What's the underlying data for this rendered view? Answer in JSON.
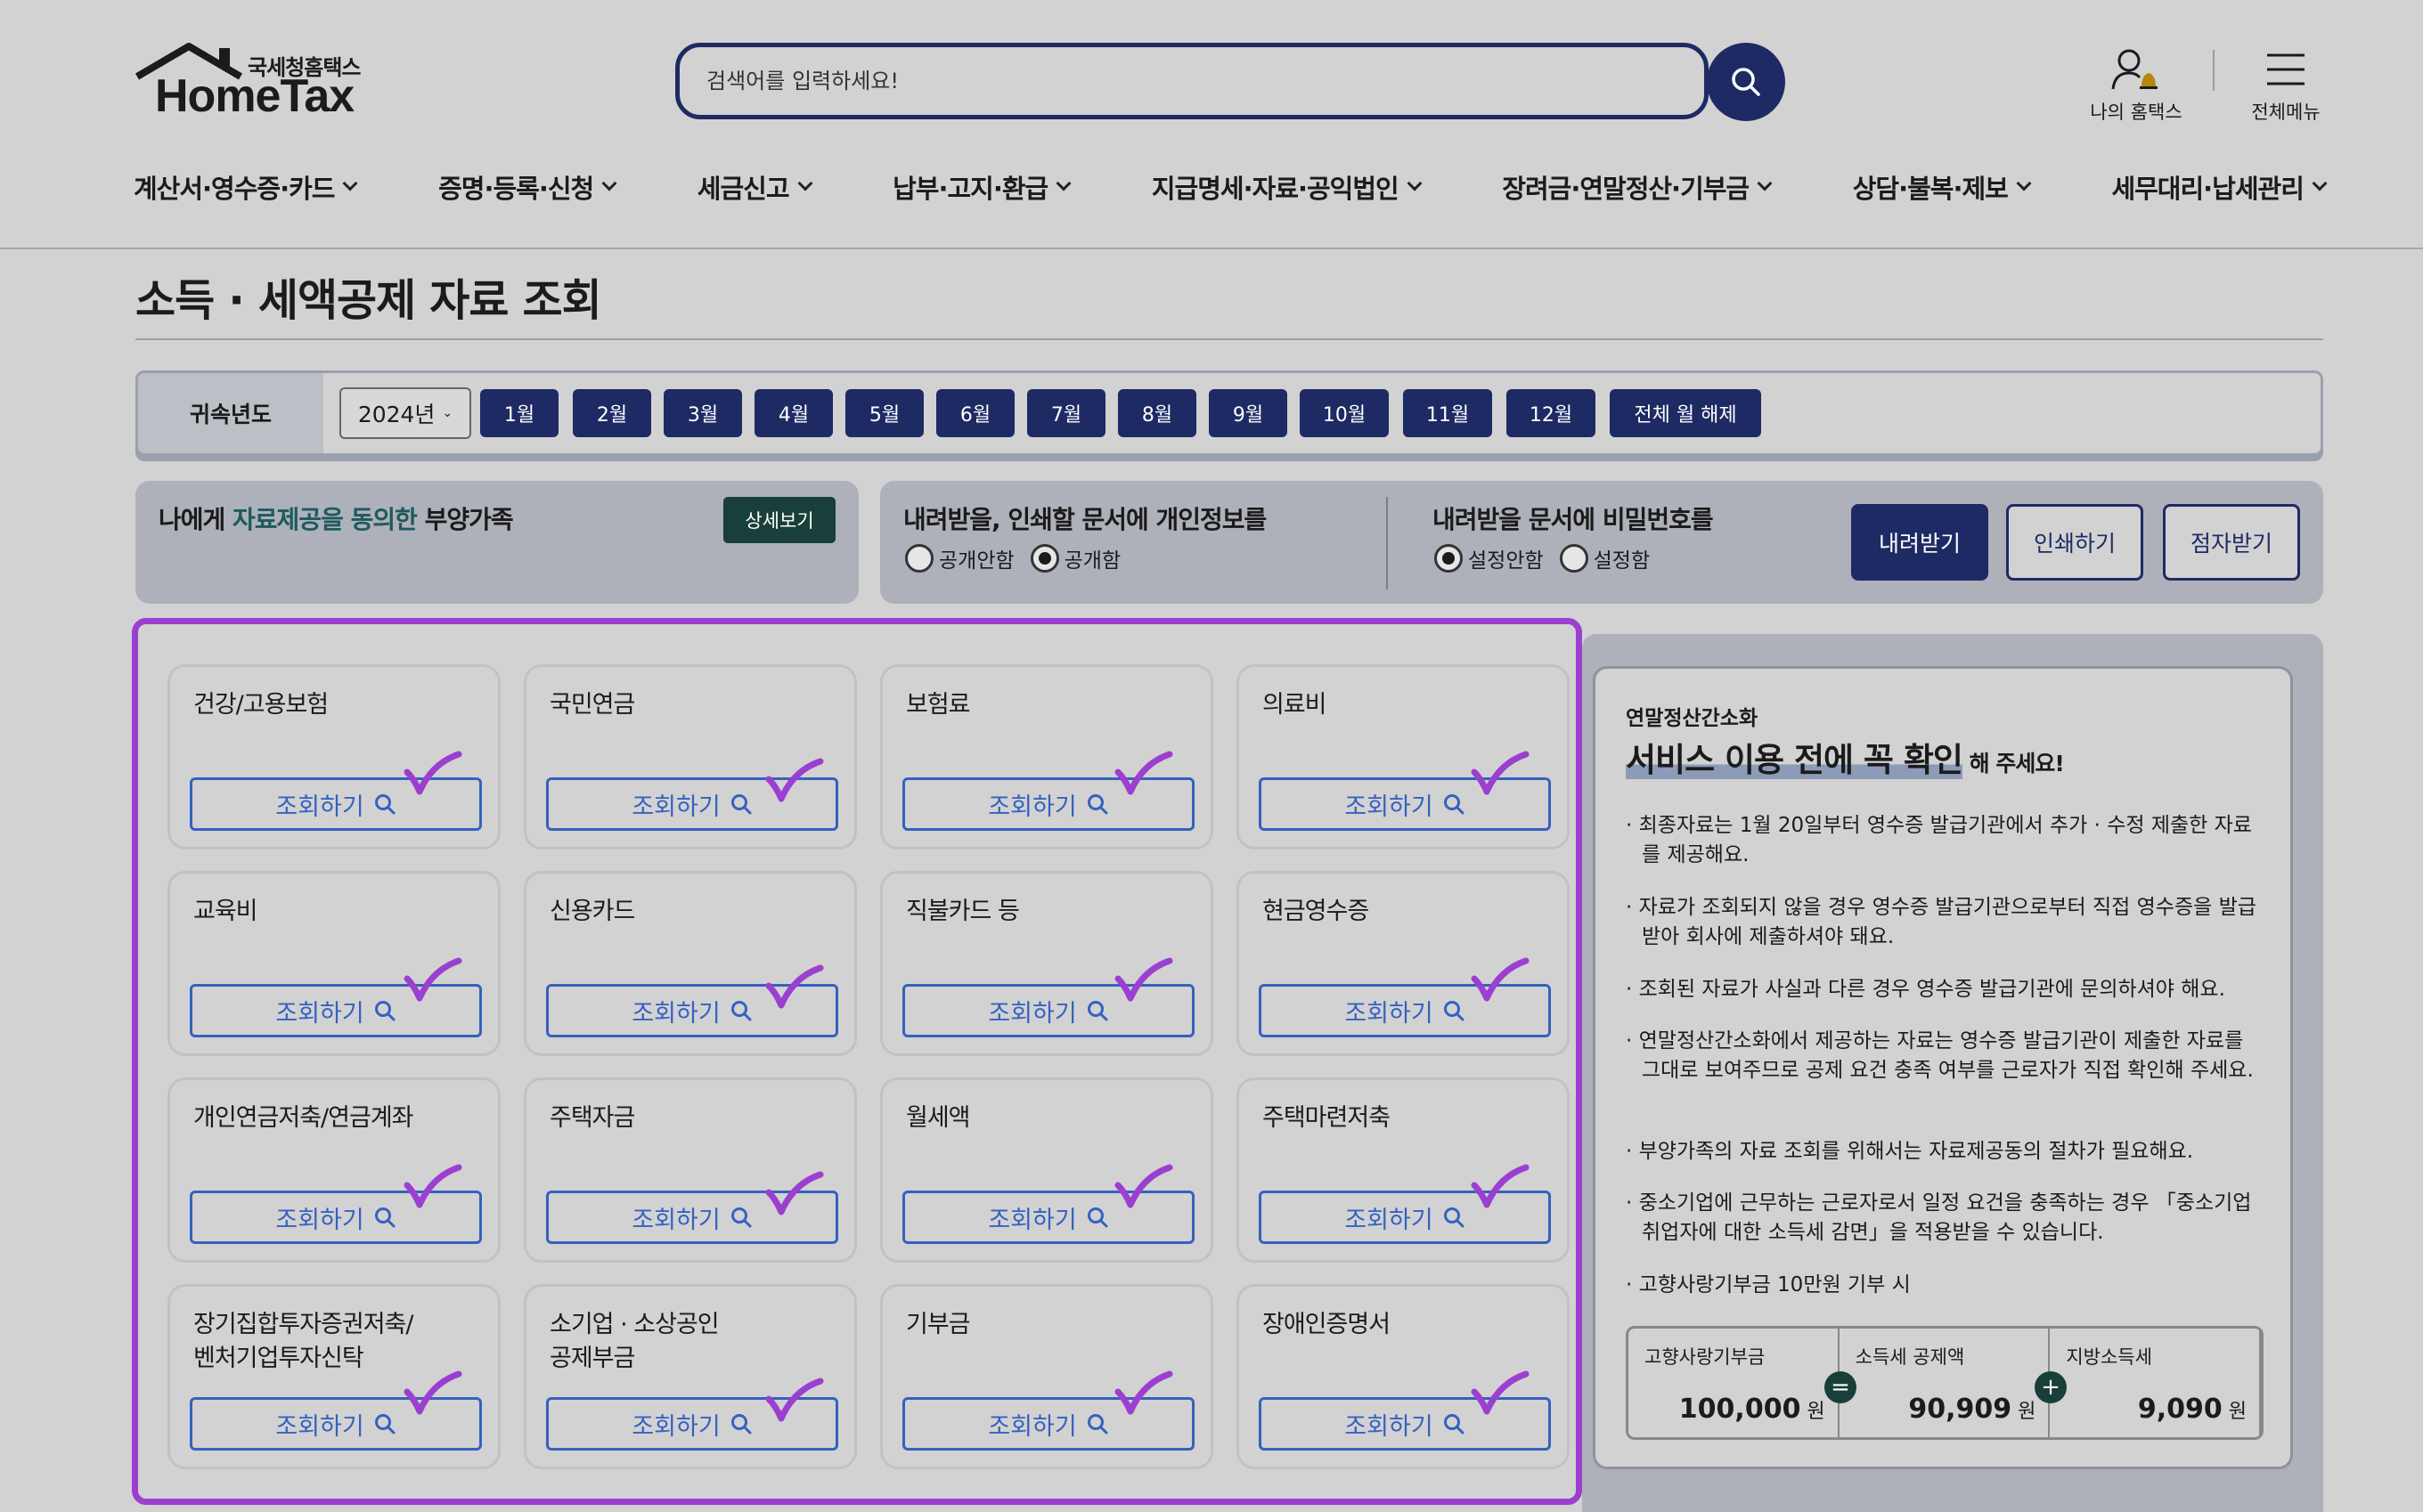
{
  "header": {
    "logo_sub": "국세청홈택스",
    "logo_main": "HomeTax",
    "search_placeholder": "검색어를 입력하세요!",
    "my_hometax": "나의 홈택스",
    "all_menu": "전체메뉴"
  },
  "nav": [
    "계산서·영수증·카드",
    "증명·등록·신청",
    "세금신고",
    "납부·고지·환급",
    "지급명세·자료·공익법인",
    "장려금·연말정산·기부금",
    "상담·불복·제보",
    "세무대리·납세관리"
  ],
  "page_title": "소득 · 세액공제 자료 조회",
  "year_bar": {
    "label": "귀속년도",
    "year": "2024년",
    "months": [
      "1월",
      "2월",
      "3월",
      "4월",
      "5월",
      "6월",
      "7월",
      "8월",
      "9월",
      "10월",
      "11월",
      "12월"
    ],
    "clear": "전체 월 해제"
  },
  "consent_panel": {
    "text_a": "나에게 ",
    "text_b": "자료제공을 동의한",
    "text_c": " 부양가족",
    "detail_button": "상세보기"
  },
  "options_panel": {
    "personal_info_title": "내려받을, 인쇄할 문서에 개인정보를",
    "personal_info_options": [
      "공개안함",
      "공개함"
    ],
    "personal_info_selected": "공개함",
    "password_title": "내려받을 문서에 비밀번호를",
    "password_options": [
      "설정안함",
      "설정함"
    ],
    "password_selected": "설정안함",
    "download": "내려받기",
    "print": "인쇄하기",
    "braille": "점자받기"
  },
  "query_label": "조회하기",
  "cards": [
    "건강/고용보험",
    "국민연금",
    "보험료",
    "의료비",
    "교육비",
    "신용카드",
    "직불카드 등",
    "현금영수증",
    "개인연금저축/연금계좌",
    "주택자금",
    "월세액",
    "주택마련저축",
    "장기집합투자증권저축/\n벤처기업투자신탁",
    "소기업 · 소상공인\n공제부금",
    "기부금",
    "장애인증명서"
  ],
  "side": {
    "kicker": "연말정산간소화",
    "headline": "서비스 이용 전에 꼭 확인",
    "headline_suffix": " 해 주세요!",
    "bullets": [
      "· 최종자료는 1월 20일부터 영수증 발급기관에서 추가 · 수정 제출한 자료를 제공해요.",
      "· 자료가 조회되지 않을 경우 영수증 발급기관으로부터 직접 영수증을 발급받아 회사에 제출하셔야 돼요.",
      "· 조회된 자료가 사실과 다른 경우 영수증 발급기관에 문의하셔야 해요.",
      "· 연말정산간소화에서 제공하는 자료는 영수증 발급기관이 제출한 자료를 그대로 보여주므로 공제 요건 충족 여부를 근로자가 직접 확인해 주세요.",
      "· 부양가족의 자료 조회를 위해서는 자료제공동의 절차가 필요해요.",
      "· 중소기업에 근무하는 근로자로서 일정 요건을 충족하는 경우 「중소기업 취업자에 대한 소득세 감면」을 적용받을 수 있습니다.",
      "· 고향사랑기부금 10만원 기부 시"
    ],
    "table": [
      {
        "label": "고향사랑기부금",
        "value": "100,000",
        "unit": " 원"
      },
      {
        "label": "소득세 공제액",
        "value": "90,909",
        "unit": " 원"
      },
      {
        "label": "지방소득세",
        "value": "9,090",
        "unit": " 원"
      }
    ],
    "op_equal": "=",
    "op_plus": "+"
  },
  "colors": {
    "navy": "#1e2a63",
    "link_blue": "#3561c0",
    "highlight_purple": "#9b3fd0",
    "dark_green": "#183f3a"
  }
}
